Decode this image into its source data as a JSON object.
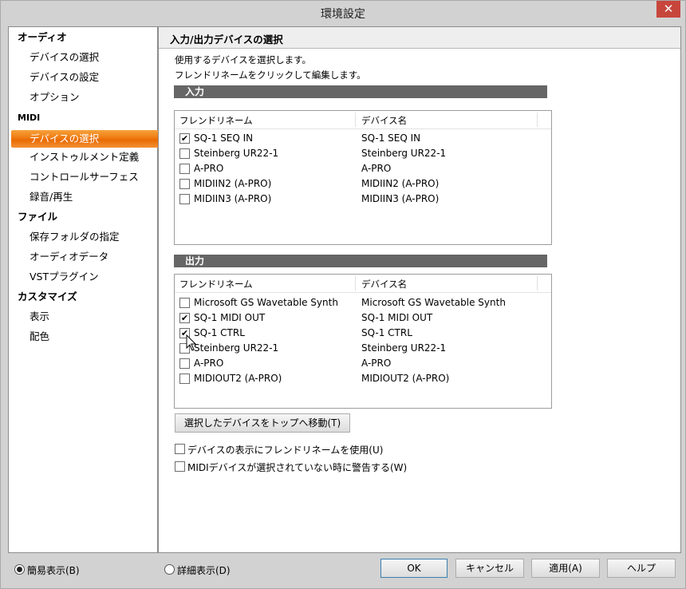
{
  "window": {
    "title": "環境設定",
    "close_glyph": "✕"
  },
  "nav": {
    "groups": [
      {
        "label": "オーディオ",
        "items": [
          "デバイスの選択",
          "デバイスの設定",
          "オプション"
        ]
      },
      {
        "label": "MIDI",
        "items": [
          "デバイスの選択",
          "インストゥルメント定義",
          "コントロールサーフェス",
          "録音/再生"
        ]
      },
      {
        "label": "ファイル",
        "items": [
          "保存フォルダの指定",
          "オーディオデータ",
          "VSTプラグイン"
        ]
      },
      {
        "label": "カスタマイズ",
        "items": [
          "表示",
          "配色"
        ]
      }
    ],
    "selected": "MIDI > デバイスの選択"
  },
  "content": {
    "title": "入力/出力デバイスの選択",
    "desc1": "使用するデバイスを選択します。",
    "desc2": "フレンドリネームをクリックして編集します。",
    "input": {
      "section": "入力",
      "col_friendly": "フレンドリネーム",
      "col_device": "デバイス名",
      "rows": [
        {
          "name": "SQ-1 SEQ IN",
          "device": "SQ-1 SEQ IN",
          "check": "✔"
        },
        {
          "name": "Steinberg UR22-1",
          "device": "Steinberg UR22-1",
          "check": ""
        },
        {
          "name": "A-PRO",
          "device": "A-PRO",
          "check": ""
        },
        {
          "name": "MIDIIN2 (A-PRO)",
          "device": "MIDIIN2 (A-PRO)",
          "check": ""
        },
        {
          "name": "MIDIIN3 (A-PRO)",
          "device": "MIDIIN3 (A-PRO)",
          "check": ""
        }
      ]
    },
    "output": {
      "section": "出力",
      "col_friendly": "フレンドリネーム",
      "col_device": "デバイス名",
      "rows": [
        {
          "name": "Microsoft GS Wavetable Synth",
          "device": "Microsoft GS Wavetable Synth",
          "check": ""
        },
        {
          "name": "SQ-1 MIDI OUT",
          "device": "SQ-1 MIDI OUT",
          "check": "✔"
        },
        {
          "name": "SQ-1 CTRL",
          "device": "SQ-1 CTRL",
          "check": "✔"
        },
        {
          "name": "Steinberg UR22-1",
          "device": "Steinberg UR22-1",
          "check": ""
        },
        {
          "name": "A-PRO",
          "device": "A-PRO",
          "check": ""
        },
        {
          "name": "MIDIOUT2 (A-PRO)",
          "device": "MIDIOUT2 (A-PRO)",
          "check": ""
        }
      ]
    },
    "move_top_button": "選択したデバイスをトップへ移動(T)",
    "option_friendly": "デバイスの表示にフレンドリネームを使用(U)",
    "option_warn": "MIDIデバイスが選択されていない時に警告する(W)"
  },
  "footer": {
    "radio_simple": "簡易表示(B)",
    "radio_detail": "詳細表示(D)",
    "ok": "OK",
    "cancel": "キャンセル",
    "apply": "適用(A)",
    "help": "ヘルプ"
  }
}
